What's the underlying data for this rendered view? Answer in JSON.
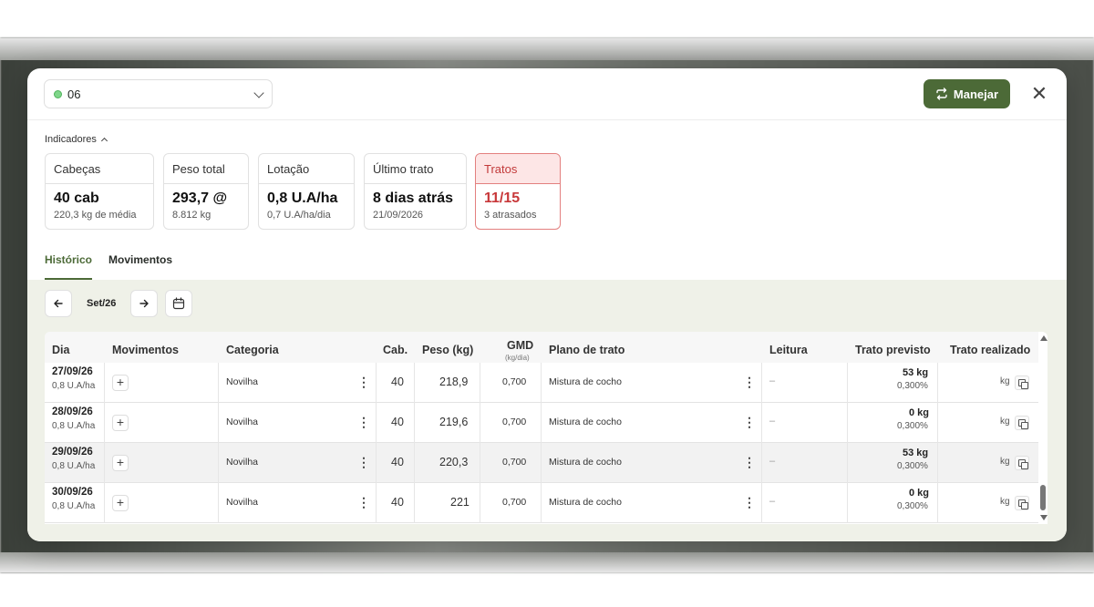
{
  "lot": {
    "name": "06",
    "status_color": "#7fd68a"
  },
  "header": {
    "action_label": "Manejar",
    "accent": "#4c6a37"
  },
  "indicators": {
    "toggle_label": "Indicadores",
    "cards": [
      {
        "title": "Cabeças",
        "value": "40 cab",
        "sub": "220,3 kg de média"
      },
      {
        "title": "Peso total",
        "value": "293,7 @",
        "sub": "8.812 kg"
      },
      {
        "title": "Lotação",
        "value": "0,8 U.A/ha",
        "sub": "0,7 U.A/ha/dia"
      },
      {
        "title": "Último trato",
        "value": "8 dias atrás",
        "sub": "21/09/2026"
      },
      {
        "title": "Tratos",
        "value": "11/15",
        "sub": "3 atrasados",
        "alert_color": "#c8383a"
      }
    ]
  },
  "tabs": [
    {
      "label": "Histórico",
      "active": true
    },
    {
      "label": "Movimentos",
      "active": false
    }
  ],
  "period": {
    "label": "Set/26"
  },
  "table": {
    "columns": {
      "dia": "Dia",
      "movimentos": "Movimentos",
      "categoria": "Categoria",
      "cab": "Cab.",
      "peso": "Peso (kg)",
      "gmd": "GMD",
      "gmd_unit": "(kg/dia)",
      "plano": "Plano de trato",
      "leitura": "Leitura",
      "previsto": "Trato previsto",
      "realizado": "Trato realizado"
    },
    "rows": [
      {
        "date": "27/09/26",
        "ua": "0,8 U.A/ha",
        "categoria": "Novilha",
        "cab": "40",
        "peso": "218,9",
        "gmd": "0,700",
        "plano": "Mistura de cocho",
        "leitura": "–",
        "previsto": "53 kg",
        "previsto_pct": "0,300%",
        "realizado_unit": "kg"
      },
      {
        "date": "28/09/26",
        "ua": "0,8 U.A/ha",
        "categoria": "Novilha",
        "cab": "40",
        "peso": "219,6",
        "gmd": "0,700",
        "plano": "Mistura de cocho",
        "leitura": "–",
        "previsto": "0 kg",
        "previsto_pct": "0,300%",
        "realizado_unit": "kg"
      },
      {
        "date": "29/09/26",
        "ua": "0,8 U.A/ha",
        "categoria": "Novilha",
        "cab": "40",
        "peso": "220,3",
        "gmd": "0,700",
        "plano": "Mistura de cocho",
        "leitura": "–",
        "previsto": "53 kg",
        "previsto_pct": "0,300%",
        "realizado_unit": "kg"
      },
      {
        "date": "30/09/26",
        "ua": "0,8 U.A/ha",
        "categoria": "Novilha",
        "cab": "40",
        "peso": "221",
        "gmd": "0,700",
        "plano": "Mistura de cocho",
        "leitura": "–",
        "previsto": "0 kg",
        "previsto_pct": "0,300%",
        "realizado_unit": "kg"
      }
    ]
  }
}
